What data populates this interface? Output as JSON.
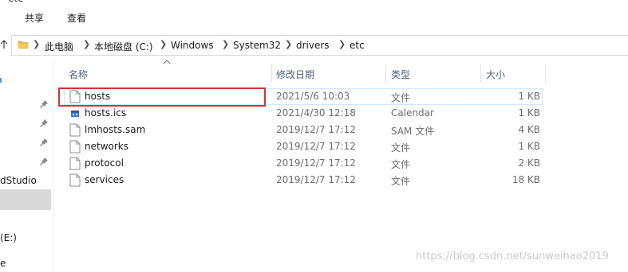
{
  "window": {
    "title_fragment": "etc"
  },
  "ribbon": {
    "tabs": [
      {
        "label": "共享"
      },
      {
        "label": "查看"
      }
    ]
  },
  "address": {
    "crumbs": [
      {
        "label": "此电脑"
      },
      {
        "label": "本地磁盘 (C:)"
      },
      {
        "label": "Windows"
      },
      {
        "label": "System32"
      },
      {
        "label": "drivers"
      },
      {
        "label": "etc"
      }
    ]
  },
  "nav": {
    "items": [
      {
        "label": "dStudio"
      },
      {
        "label": "(E:)"
      },
      {
        "label": "e"
      }
    ]
  },
  "columns": {
    "name": "名称",
    "date": "修改日期",
    "type": "类型",
    "size": "大小"
  },
  "files": [
    {
      "name": "hosts",
      "date": "2021/5/6 10:03",
      "type": "文件",
      "size": "1 KB",
      "icon": "file-icon"
    },
    {
      "name": "hosts.ics",
      "date": "2021/4/30 12:18",
      "type": "Calendar",
      "size": "1 KB",
      "icon": "calendar-file-icon"
    },
    {
      "name": "lmhosts.sam",
      "date": "2019/12/7 17:12",
      "type": "SAM 文件",
      "size": "4 KB",
      "icon": "file-icon"
    },
    {
      "name": "networks",
      "date": "2019/12/7 17:12",
      "type": "文件",
      "size": "1 KB",
      "icon": "file-icon"
    },
    {
      "name": "protocol",
      "date": "2019/12/7 17:12",
      "type": "文件",
      "size": "2 KB",
      "icon": "file-icon"
    },
    {
      "name": "services",
      "date": "2019/12/7 17:12",
      "type": "文件",
      "size": "18 KB",
      "icon": "file-icon"
    }
  ],
  "watermark": "https://blog.csdn.net/sunweihao2019",
  "colors": {
    "highlight": "#d13438",
    "header_text": "#4d6082",
    "folder": "#e8b545"
  }
}
